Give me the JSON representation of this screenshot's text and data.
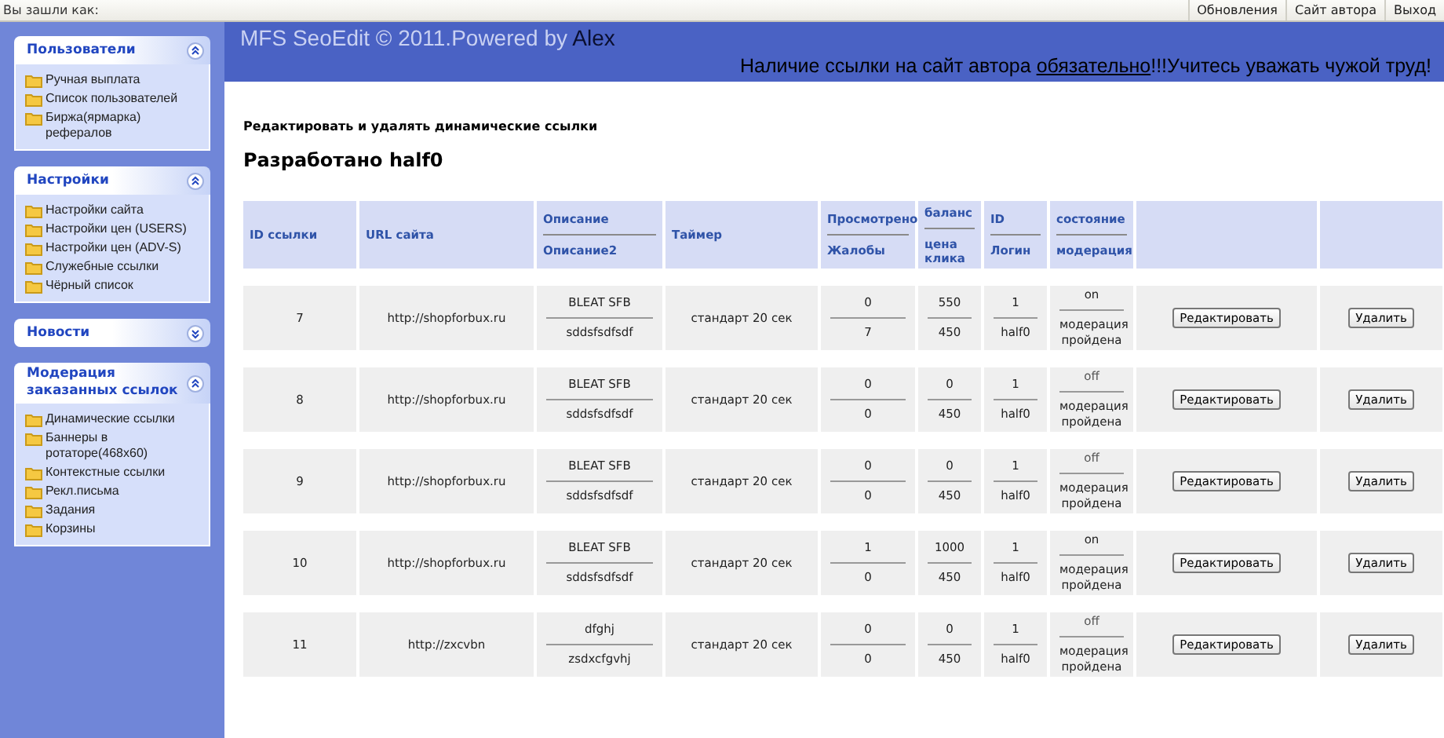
{
  "top_bar": {
    "login_label": "Вы зашли как:",
    "links": [
      "Обновления",
      "Сайт автора",
      "Выход"
    ]
  },
  "sidebar": {
    "panels": [
      {
        "title": "Пользователи",
        "expanded": true,
        "items": [
          "Ручная выплата",
          "Список пользователей",
          "Биржа(ярмарка) рефералов"
        ]
      },
      {
        "title": "Настройки",
        "expanded": true,
        "items": [
          "Настройки сайта",
          "Настройки цен (USERS)",
          "Настройки цен (ADV-S)",
          "Служебные ссылки",
          "Чёрный список"
        ]
      },
      {
        "title": "Новости",
        "expanded": false
      },
      {
        "title": "Модерация заказанных ссылок",
        "expanded": true,
        "items": [
          "Динамические ссылки",
          "Баннеры в ротаторе(468x60)",
          "Контекстные ссылки",
          "Рекл.письма",
          "Задания",
          "Корзины"
        ]
      }
    ]
  },
  "header": {
    "title": "MFS SeoEdit © 2011.Powered by",
    "author": "Alex",
    "notice_before": "Наличие ссылки на сайт автора",
    "notice_link": "обязательно",
    "notice_after": "!!!Учитесь уважать чужой труд!"
  },
  "page_title": "Редактировать и удалять динамические ссылки",
  "developer": "Разработано half0",
  "table": {
    "columns": [
      [
        "ID ссылки"
      ],
      [
        "URL сайта"
      ],
      [
        "Описание",
        "Описание2"
      ],
      [
        "Таймер"
      ],
      [
        "Просмотрено",
        "Жалобы"
      ],
      [
        "баланс",
        "цена клика"
      ],
      [
        "ID",
        "Логин"
      ],
      [
        "состояние",
        "модерация"
      ]
    ],
    "rows": [
      {
        "id": "7",
        "url": "http://shopforbux.ru",
        "description": "BLEAT SFB",
        "description2": "sddsfsdfsdf",
        "timer": "стандарт 20 сек",
        "viewed": "0",
        "complaints": "7",
        "balance": "550",
        "click_price": "450",
        "user_id": "1",
        "login": "half0",
        "state": "on",
        "moderation": "модерация пройдена",
        "edit": "Редактировать",
        "delete": "Удалить"
      },
      {
        "id": "8",
        "url": "http://shopforbux.ru",
        "description": "BLEAT SFB",
        "description2": "sddsfsdfsdf",
        "timer": "стандарт 20 сек",
        "viewed": "0",
        "complaints": "0",
        "balance": "0",
        "click_price": "450",
        "user_id": "1",
        "login": "half0",
        "state": "off",
        "moderation": "модерация пройдена",
        "edit": "Редактировать",
        "delete": "Удалить"
      },
      {
        "id": "9",
        "url": "http://shopforbux.ru",
        "description": "BLEAT SFB",
        "description2": "sddsfsdfsdf",
        "timer": "стандарт 20 сек",
        "viewed": "0",
        "complaints": "0",
        "balance": "0",
        "click_price": "450",
        "user_id": "1",
        "login": "half0",
        "state": "off",
        "moderation": "модерация пройдена",
        "edit": "Редактировать",
        "delete": "Удалить"
      },
      {
        "id": "10",
        "url": "http://shopforbux.ru",
        "description": "BLEAT SFB",
        "description2": "sddsfsdfsdf",
        "timer": "стандарт 20 сек",
        "viewed": "1",
        "complaints": "0",
        "balance": "1000",
        "click_price": "450",
        "user_id": "1",
        "login": "half0",
        "state": "on",
        "moderation": "модерация пройдена",
        "edit": "Редактировать",
        "delete": "Удалить"
      },
      {
        "id": "11",
        "url": "http://zxcvbn",
        "description": "dfghj",
        "description2": "zsdxcfgvhj",
        "timer": "стандарт 20 сек",
        "viewed": "0",
        "complaints": "0",
        "balance": "0",
        "click_price": "450",
        "user_id": "1",
        "login": "half0",
        "state": "off",
        "moderation": "модерация пройдена",
        "edit": "Редактировать",
        "delete": "Удалить"
      }
    ]
  }
}
